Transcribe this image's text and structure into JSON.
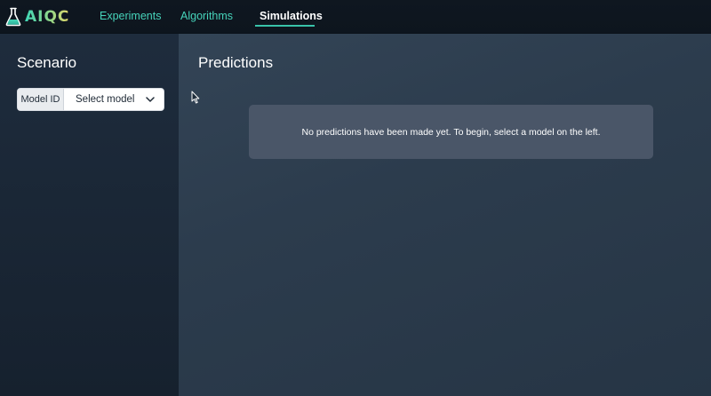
{
  "header": {
    "brand": "AIQC",
    "nav": [
      {
        "label": "Experiments",
        "active": false
      },
      {
        "label": "Algorithms",
        "active": false
      },
      {
        "label": "Simulations",
        "active": true
      }
    ]
  },
  "sidebar": {
    "title": "Scenario",
    "model_select": {
      "addon_label": "Model ID",
      "selected_value": "Select model"
    }
  },
  "main": {
    "title": "Predictions",
    "empty_message": "No predictions have been made yet. To begin, select a model on the left."
  },
  "colors": {
    "nav_accent": "#46d3ba",
    "nav_background": "#0f1720",
    "sidebar_background": "#1e2c3d",
    "main_background": "#2f4052",
    "panel_background": "#4a5668"
  },
  "icons": {
    "brand": "flask-icon",
    "select": "chevron-down-icon",
    "pointer": "mouse-cursor-icon"
  }
}
